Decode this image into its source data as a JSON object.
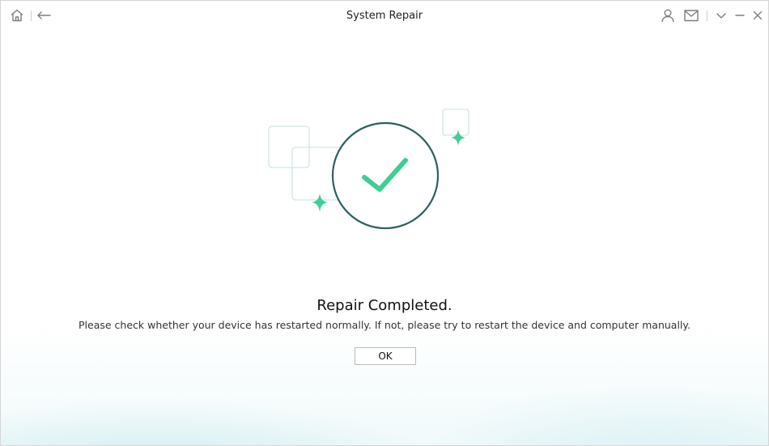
{
  "window": {
    "title": "System Repair"
  },
  "titlebar": {
    "left_icons": [
      "home-icon",
      "back-arrow-icon"
    ],
    "right_icons": [
      "user-icon",
      "mail-icon",
      "chevron-down-icon",
      "minimize-icon",
      "close-icon"
    ]
  },
  "result": {
    "heading": "Repair Completed.",
    "message": "Please check whether your device has restarted normally. If not, please try to restart the device and computer manually.",
    "ok_label": "OK"
  },
  "colors": {
    "accent_green": "#3ecf96",
    "ring": "#2f5f60",
    "frame": "#cfe6e6"
  }
}
